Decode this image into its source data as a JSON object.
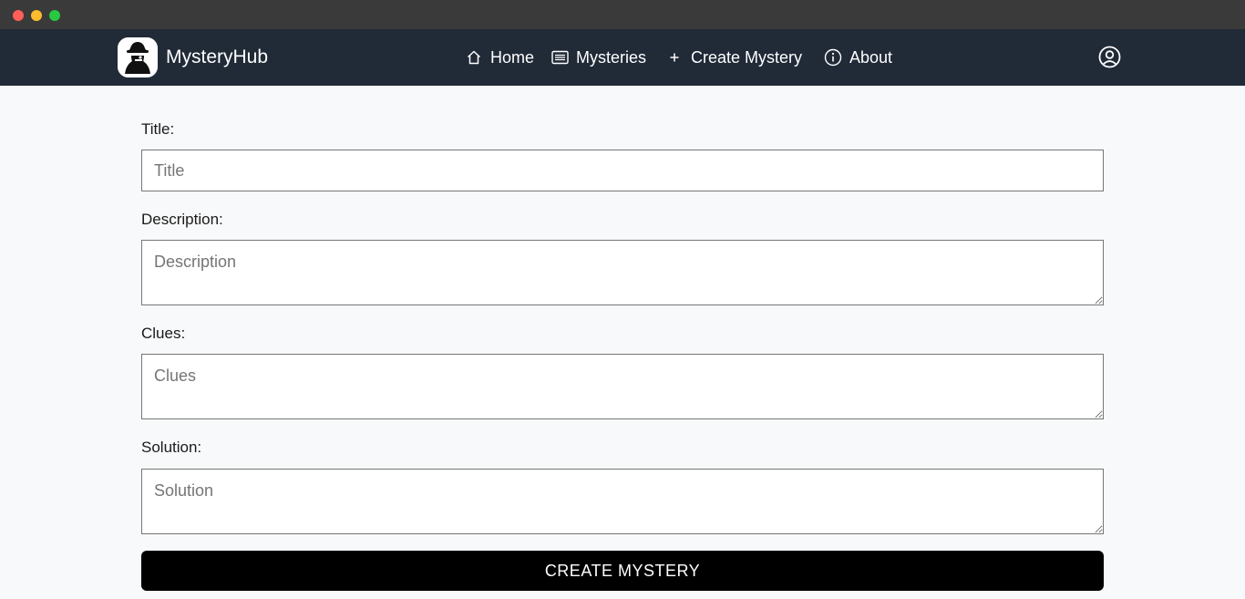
{
  "window": {
    "controls": [
      "close",
      "minimize",
      "maximize"
    ]
  },
  "navbar": {
    "brand": "MysteryHub",
    "logo_icon": "detective-icon",
    "links": [
      {
        "label": "Home",
        "icon": "home-icon"
      },
      {
        "label": "Mysteries",
        "icon": "list-icon"
      },
      {
        "label": "Create Mystery",
        "icon": "plus-icon"
      },
      {
        "label": "About",
        "icon": "info-icon"
      }
    ],
    "profile_icon": "user-circle-icon"
  },
  "form": {
    "title": {
      "label": "Title:",
      "placeholder": "Title",
      "value": ""
    },
    "description": {
      "label": "Description:",
      "placeholder": "Description",
      "value": ""
    },
    "clues": {
      "label": "Clues:",
      "placeholder": "Clues",
      "value": ""
    },
    "solution": {
      "label": "Solution:",
      "placeholder": "Solution",
      "value": ""
    },
    "submit_label": "CREATE MYSTERY"
  },
  "colors": {
    "navbar_bg": "#212a37",
    "page_bg": "#f8f9fa",
    "button_bg": "#000000"
  }
}
